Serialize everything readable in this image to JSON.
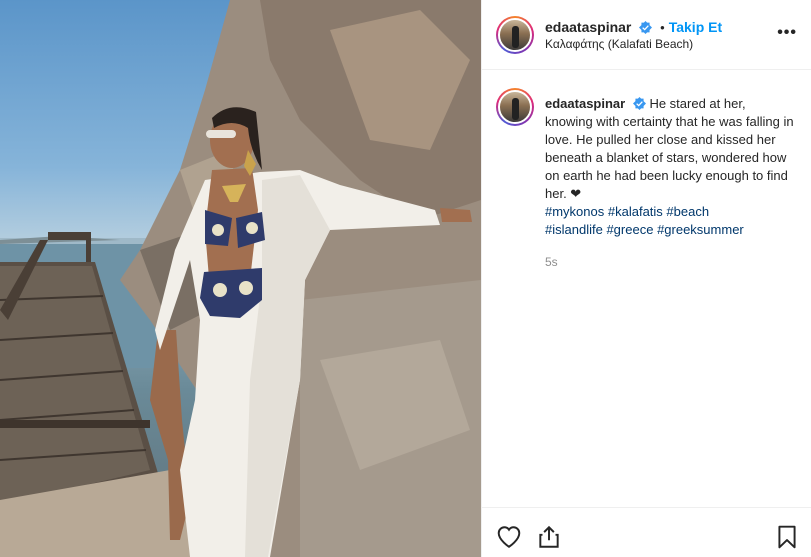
{
  "post": {
    "username": "edaataspinar",
    "follow_label": "Takip Et",
    "separator": "•",
    "location": "Καλαφάτης (Kalafati Beach)",
    "more_label": "•••",
    "caption_text": "He stared at her, knowing with certainty that he was falling in love. He pulled her close and kissed her beneath a blanket of stars, wondered how on earth he had been lucky enough to find her. ❤",
    "hashtags": [
      "#mykonos",
      "#kalafatis",
      "#beach",
      "#islandlife",
      "#greece",
      "#greeksummer"
    ],
    "time_ago": "5s"
  },
  "icons": {
    "verified": "verified-badge-icon",
    "like": "heart-icon",
    "share": "share-icon",
    "save": "bookmark-icon"
  },
  "colors": {
    "accent": "#0095f6",
    "hashtag": "#00376b",
    "verified": "#3897f0",
    "muted": "#8e8e8e"
  }
}
